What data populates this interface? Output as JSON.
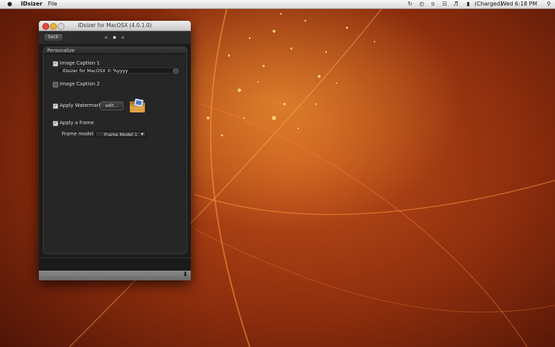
{
  "menubar": {
    "app_name": "IDsizer",
    "menus": [
      "File"
    ],
    "battery_status": "(Charged)",
    "clock": "Wed 6:18 PM"
  },
  "window": {
    "title": "IDsizer for MacOSX (4.0.1.0)",
    "back_label": "back",
    "pages": 3,
    "active_page": 2
  },
  "personalize": {
    "header": "Personalize",
    "caption1": {
      "label": "Image Caption 1",
      "checked": true,
      "value": "IDsizer for MacOSX © %yyyy"
    },
    "caption2": {
      "label": "Image Caption 2",
      "checked": false
    },
    "watermark": {
      "label": "Apply Watermark",
      "checked": true,
      "edit_label": "edit..."
    },
    "frame": {
      "label": "Apply a frame",
      "checked": true,
      "model_label": "Frame model",
      "model_value": "Frame Model 1"
    }
  },
  "icons": {
    "apple": "apple-logo-icon",
    "watermark": "folder-image-icon",
    "download": "download-arrow-icon"
  },
  "colors": {
    "accent_orange": "#c2501a",
    "panel_bg": "#262626"
  }
}
